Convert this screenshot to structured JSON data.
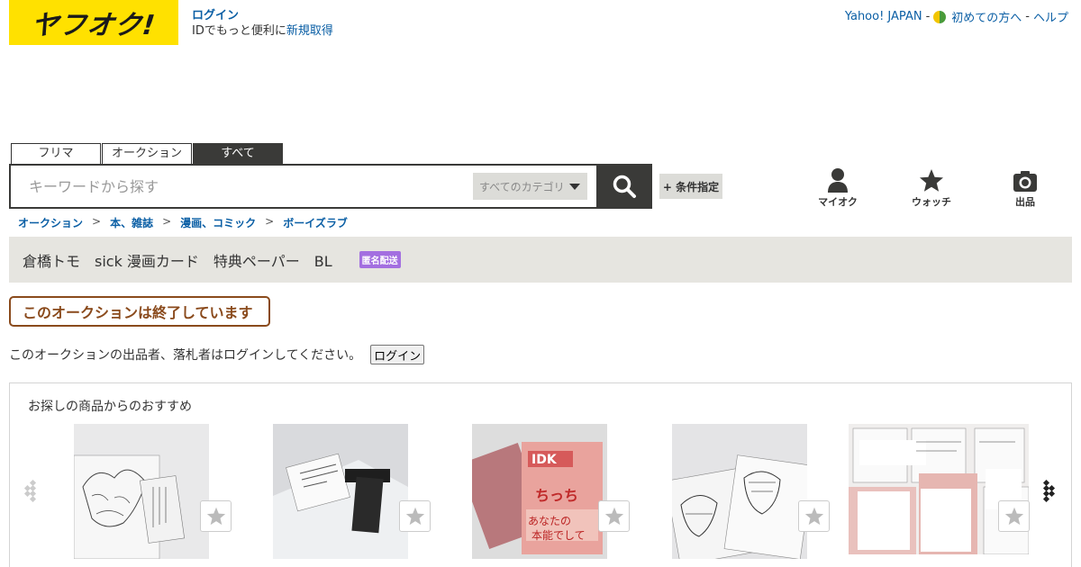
{
  "header": {
    "logo_text": "ヤフオク!",
    "login_link": "ログイン",
    "id_prompt": "IDでもっと便利に",
    "signup_link": "新規取得",
    "links": {
      "yahoo": "Yahoo! JAPAN",
      "beginners": "初めての方へ",
      "help": "ヘルプ",
      "separator": "-"
    }
  },
  "search": {
    "tabs": [
      "フリマ",
      "オークション",
      "すべて"
    ],
    "active_tab": "すべて",
    "placeholder": "キーワードから探す",
    "category": "すべてのカテゴリ",
    "conditions_button": "+ 条件指定"
  },
  "nav": {
    "my_auction": "マイオク",
    "watch": "ウォッチ",
    "sell": "出品"
  },
  "breadcrumb": [
    "オークション",
    "本、雑誌",
    "漫画、コミック",
    "ボーイズラブ"
  ],
  "breadcrumb_separator": ">",
  "listing": {
    "title": "倉橋トモ　sick 漫画カード　特典ペーパー　BL",
    "badge": "匿名配送",
    "ended_notice": "このオークションは終了しています",
    "login_notice": "このオークションの出品者、落札者はログインしてください。",
    "login_button": "ログイン"
  },
  "recommendations": {
    "title": "お探しの商品からのおすすめ",
    "items": [
      {
        "icon": "manga-card-thumbnail"
      },
      {
        "icon": "manga-paper-thumbnail"
      },
      {
        "icon": "comic-book-thumbnail"
      },
      {
        "icon": "manga-illustration-thumbnail"
      },
      {
        "icon": "manga-pages-collage-thumbnail"
      }
    ]
  },
  "colors": {
    "brand_yellow": "#ffe100",
    "dark": "#3a3a38",
    "link": "#0b5fa5",
    "ended_border": "#8a4a1c",
    "badge": "#a36fe0",
    "tag_bar": "#e6e5e0"
  }
}
